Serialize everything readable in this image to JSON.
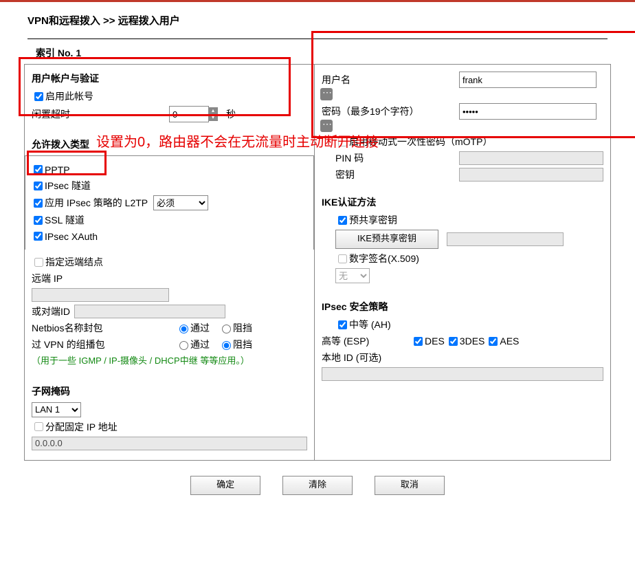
{
  "breadcrumb": "VPN和远程拨入 >> 远程拨入用户",
  "index_label": "索引 No. 1",
  "annotation": "设置为0，路由器不会在无流量时主动断开连接",
  "left": {
    "sect_account": "用户帐户与验证",
    "enable_account": "启用此帐号",
    "idle_timeout_label": "闲置超时",
    "idle_timeout_value": "0",
    "idle_unit": "秒",
    "sect_allow": "允许拨入类型",
    "pptp": "PPTP",
    "ipsec_tunnel": "IPsec 隧道",
    "l2tp_ipsec": "应用 IPsec 策略的 L2TP",
    "l2tp_select": "必须",
    "ssl_tunnel": "SSL 隧道",
    "ipsec_xauth": "IPsec XAuth",
    "specify_remote": "指定远端结点",
    "remote_ip": "远端 IP",
    "remote_ip_value": "",
    "or_peer_id": "或对端ID",
    "peer_id_value": "",
    "netbios": "Netbios名称封包",
    "multicast": "过 VPN 的组播包",
    "pass": "通过",
    "block": "阻挡",
    "multicast_note": "（用于一些 IGMP / IP-摄像头 / DHCP中继 等等应用。）",
    "subnet_title": "子网掩码",
    "lan_select": "LAN 1",
    "assign_ip": "分配固定 IP 地址",
    "fixed_ip": "0.0.0.0"
  },
  "right": {
    "username_label": "用户名",
    "username_value": "frank",
    "password_label": "密码（最多19个字符）",
    "password_value": "•••••",
    "motp": "启用移动式一次性密码（mOTP）",
    "pin_label": "PIN 码",
    "pin_value": "",
    "secret_label": "密钥",
    "secret_value": "",
    "ike_title": "IKE认证方法",
    "psk": "预共享密钥",
    "psk_btn": "IKE预共享密钥",
    "psk_value": "",
    "digisig": "数字签名(X.509)",
    "digisig_select": "无",
    "ipsec_policy_title": "IPsec 安全策略",
    "medium": "中等 (AH)",
    "high": "高等 (ESP)",
    "des": "DES",
    "tdes": "3DES",
    "aes": "AES",
    "local_id": "本地 ID (可选)",
    "local_id_value": ""
  },
  "buttons": {
    "ok": "确定",
    "clear": "清除",
    "cancel": "取消"
  }
}
